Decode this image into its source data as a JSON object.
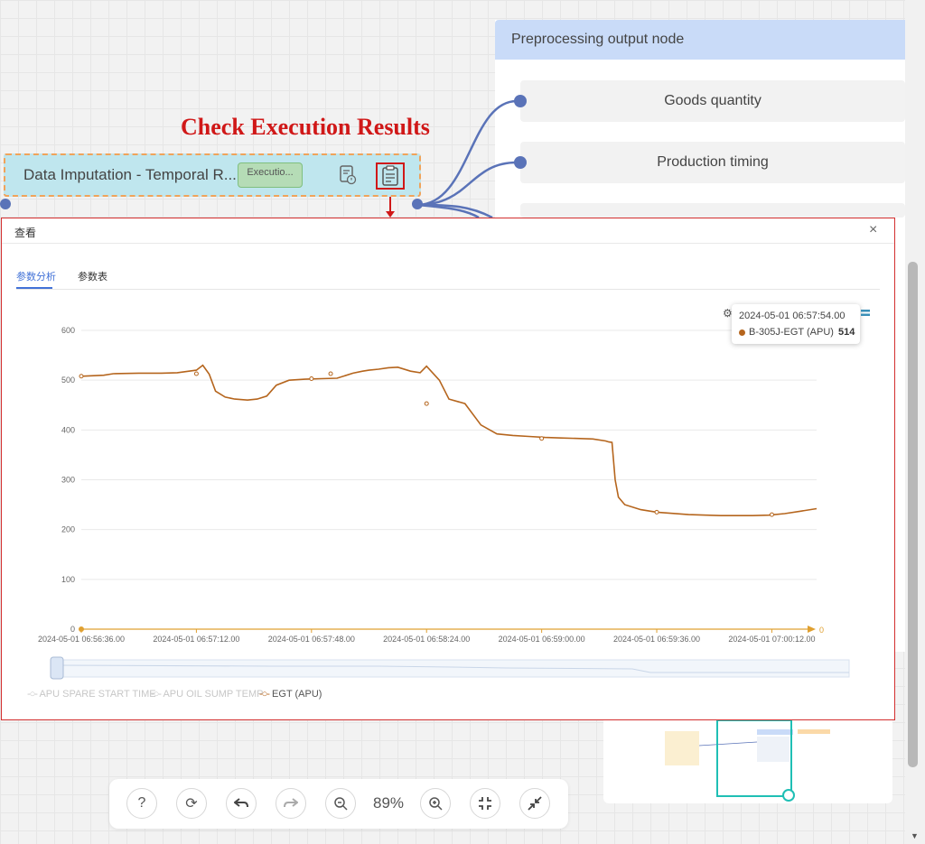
{
  "annotation": "Check Execution Results",
  "output_panel": {
    "title": "Preprocessing output node",
    "items": [
      "Goods quantity",
      "Production timing"
    ]
  },
  "node": {
    "title": "Data Imputation - Temporal R...",
    "status": "Executio..."
  },
  "dialog": {
    "title": "查看",
    "close": "×",
    "tabs": [
      "参数分析",
      "参数表"
    ]
  },
  "tooltip": {
    "time": "2024-05-01 06:57:54.00",
    "series": "B-305J-EGT (APU)",
    "value": "514"
  },
  "toolbar": {
    "help": "?",
    "zoom": "89%"
  },
  "chart_data": {
    "type": "line",
    "ylim": [
      0,
      600
    ],
    "yticks": [
      "0",
      "100",
      "200",
      "300",
      "400",
      "500",
      "600"
    ],
    "xticks": [
      "2024-05-01 06:56:36.00",
      "2024-05-01 06:57:12.00",
      "2024-05-01 06:57:48.00",
      "2024-05-01 06:58:24.00",
      "2024-05-01 06:59:00.00",
      "2024-05-01 06:59:36.00",
      "2024-05-01 07:00:12.00"
    ],
    "x_end_label": "0",
    "x_range_seconds": [
      0,
      230
    ],
    "legend": [
      "APU SPARE START TIME",
      "APU OIL SUMP TEMP",
      "EGT (APU)"
    ],
    "series": [
      {
        "name": "EGT (APU)",
        "color": "#b5651d",
        "x": [
          0,
          7,
          10,
          18,
          25,
          30,
          36,
          38,
          40,
          42,
          45,
          48,
          52,
          55,
          58,
          61,
          65,
          70,
          75,
          80,
          85,
          88,
          90,
          93,
          96,
          99,
          103,
          106,
          108,
          112,
          115,
          120,
          125,
          130,
          135,
          140,
          145,
          150,
          155,
          160,
          164,
          165,
          166,
          167,
          168,
          170,
          175,
          180,
          190,
          200,
          210,
          215,
          220,
          225,
          230
        ],
        "y": [
          508,
          510,
          513,
          514,
          514,
          515,
          520,
          530,
          512,
          478,
          466,
          462,
          460,
          462,
          468,
          490,
          500,
          502,
          503,
          504,
          514,
          518,
          520,
          522,
          525,
          526,
          518,
          515,
          528,
          500,
          462,
          453,
          410,
          392,
          389,
          387,
          385,
          384,
          383,
          382,
          378,
          376,
          375,
          300,
          265,
          250,
          240,
          235,
          230,
          228,
          228,
          229,
          232,
          237,
          242
        ],
        "markers": [
          [
            0,
            508
          ],
          [
            36,
            513
          ],
          [
            72,
            503
          ],
          [
            78,
            513
          ],
          [
            108,
            453
          ],
          [
            144,
            383
          ],
          [
            180,
            235
          ],
          [
            216,
            230
          ]
        ]
      }
    ],
    "hidden_series": [
      {
        "name": "APU SPARE START TIME",
        "values": [
          0
        ]
      },
      {
        "name": "APU OIL SUMP TEMP",
        "values": [
          0
        ]
      }
    ]
  }
}
